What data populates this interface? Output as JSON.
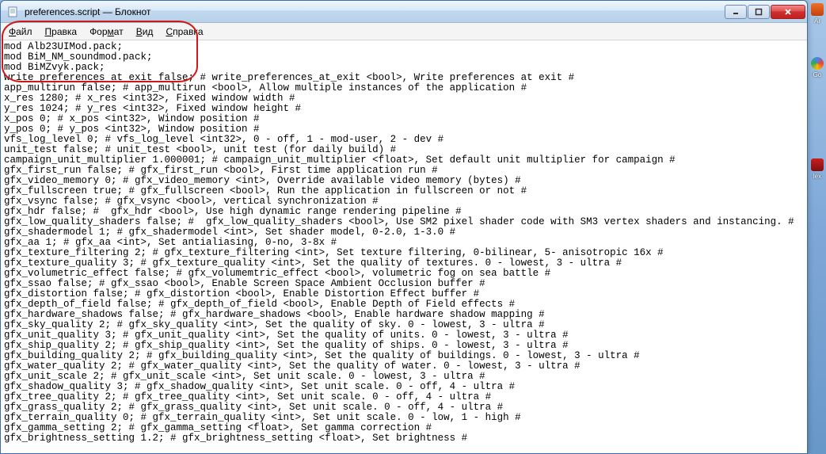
{
  "window": {
    "title": "preferences.script — Блокнот"
  },
  "menubar": {
    "file": "Файл",
    "edit": "Правка",
    "format": "Формат",
    "view": "Вид",
    "help": "Справка"
  },
  "content": {
    "text": "mod Alb23UIMod.pack;\nmod BiM_NM_soundmod.pack;\nmod BiMZvyk.pack;\nwrite_preferences_at_exit false; # write_preferences_at_exit <bool>, Write preferences at exit #\napp_multirun false; # app_multirun <bool>, Allow multiple instances of the application #\nx_res 1280; # x_res <int32>, Fixed window width #\ny_res 1024; # y_res <int32>, Fixed window height #\nx_pos 0; # x_pos <int32>, Window position #\ny_pos 0; # y_pos <int32>, Window position #\nvfs_log_level 0; # vfs_log_level <int32>, 0 - off, 1 - mod-user, 2 - dev #\nunit_test false; # unit_test <bool>, unit test (for daily build) #\ncampaign_unit_multiplier 1.000001; # campaign_unit_multiplier <float>, Set default unit multiplier for campaign #\ngfx_first_run false; # gfx_first_run <bool>, First time application run #\ngfx_video_memory 0; # gfx_video_memory <int>, Override available video memory (bytes) #\ngfx_fullscreen true; # gfx_fullscreen <bool>, Run the application in fullscreen or not #\ngfx_vsync false; # gfx_vsync <bool>, vertical synchronization #\ngfx_hdr false; #  gfx_hdr <bool>, Use high dynamic range rendering pipeline #\ngfx_low_quality_shaders false; #  gfx_low_quality_shaders <bool>, Use SM2 pixel shader code with SM3 vertex shaders and instancing. #\ngfx_shadermodel 1; # gfx_shadermodel <int>, Set shader model, 0-2.0, 1-3.0 #\ngfx_aa 1; # gfx_aa <int>, Set antialiasing, 0-no, 3-8x #\ngfx_texture_filtering 2; # gfx_texture_filtering <int>, Set texture filtering, 0-bilinear, 5- anisotropic 16x #\ngfx_texture_quality 3; # gfx_texture_quality <int>, Set the quality of textures. 0 - lowest, 3 - ultra #\ngfx_volumetric_effect false; # gfx_volumemtric_effect <bool>, volumetric fog on sea battle #\ngfx_ssao false; # gfx_ssao <bool>, Enable Screen Space Ambient Occlusion buffer #\ngfx_distortion false; # gfx_distortion <bool>, Enable Distortion Effect buffer #\ngfx_depth_of_field false; # gfx_depth_of_field <bool>, Enable Depth of Field effects #\ngfx_hardware_shadows false; # gfx_hardware_shadows <bool>, Enable hardware shadow mapping #\ngfx_sky_quality 2; # gfx_sky_quality <int>, Set the quality of sky. 0 - lowest, 3 - ultra #\ngfx_unit_quality 3; # gfx_unit_quality <int>, Set the quality of units. 0 - lowest, 3 - ultra #\ngfx_ship_quality 2; # gfx_ship_quality <int>, Set the quality of ships. 0 - lowest, 3 - ultra #\ngfx_building_quality 2; # gfx_building_quality <int>, Set the quality of buildings. 0 - lowest, 3 - ultra #\ngfx_water_quality 2; # gfx_water_quality <int>, Set the quality of water. 0 - lowest, 3 - ultra #\ngfx_unit_scale 2; # gfx_unit_scale <int>, Set unit scale. 0 - lowest, 3 - ultra #\ngfx_shadow_quality 3; # gfx_shadow_quality <int>, Set unit scale. 0 - off, 4 - ultra #\ngfx_tree_quality 2; # gfx_tree_quality <int>, Set unit scale. 0 - off, 4 - ultra #\ngfx_grass_quality 2; # gfx_grass_quality <int>, Set unit scale. 0 - off, 4 - ultra #\ngfx_terrain_quality 0; # gfx_terrain_quality <int>, Set unit scale. 0 - low, 1 - high #\ngfx_gamma_setting 2; # gfx_gamma_setting <float>, Set gamma correction #\ngfx_brightness_setting 1.2; # gfx_brightness_setting <float>, Set brightness #"
  },
  "desktop": {
    "icon1": "Ar",
    "icon2": "Go",
    "icon3": "lex"
  }
}
